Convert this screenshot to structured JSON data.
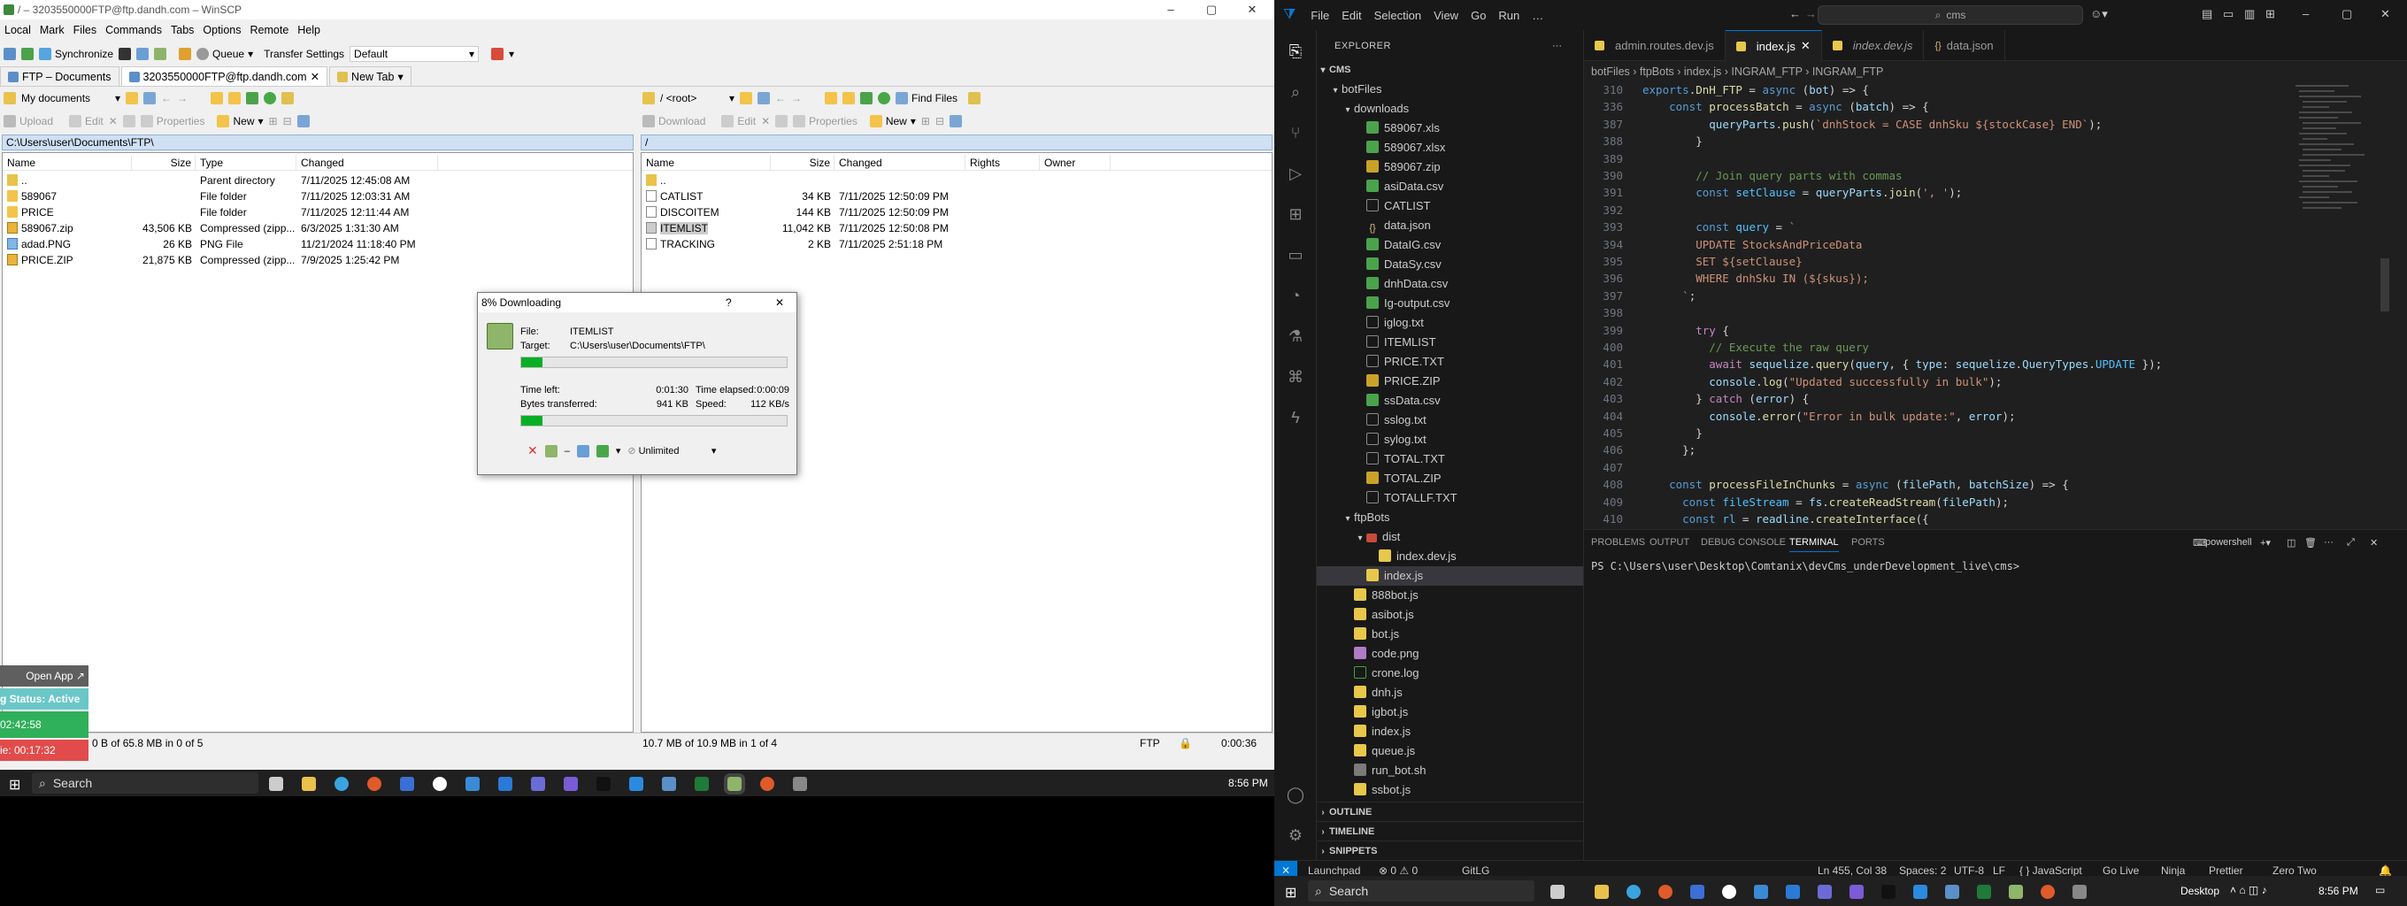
{
  "winscp": {
    "title": "/ – 3203550000FTP@ftp.dandh.com – WinSCP",
    "menu": [
      "Local",
      "Mark",
      "Files",
      "Commands",
      "Tabs",
      "Options",
      "Remote",
      "Help"
    ],
    "toolbar": {
      "synchronize": "Synchronize",
      "queue": "Queue",
      "transfer_settings": "Transfer Settings",
      "transfer_preset": "Default"
    },
    "tabs": [
      {
        "label": "FTP – Documents"
      },
      {
        "label": "3203550000FTP@ftp.dandh.com"
      },
      {
        "label": "New Tab"
      }
    ],
    "left": {
      "location": "My documents",
      "actions": {
        "upload": "Upload",
        "edit": "Edit",
        "properties": "Properties",
        "new": "New"
      },
      "path": "C:\\Users\\user\\Documents\\FTP\\",
      "headers": [
        "Name",
        "Size",
        "Type",
        "Changed"
      ],
      "rows": [
        {
          "name": "..",
          "size": "",
          "type": "Parent directory",
          "changed": "7/11/2025 12:45:08 AM",
          "icon": "up"
        },
        {
          "name": "589067",
          "size": "",
          "type": "File folder",
          "changed": "7/11/2025 12:03:31 AM",
          "icon": "folder"
        },
        {
          "name": "PRICE",
          "size": "",
          "type": "File folder",
          "changed": "7/11/2025 12:11:44 AM",
          "icon": "folder"
        },
        {
          "name": "589067.zip",
          "size": "43,506 KB",
          "type": "Compressed (zipp...",
          "changed": "6/3/2025 1:31:30 AM",
          "icon": "zip"
        },
        {
          "name": "adad.PNG",
          "size": "26 KB",
          "type": "PNG File",
          "changed": "11/21/2024 11:18:40 PM",
          "icon": "png"
        },
        {
          "name": "PRICE.ZIP",
          "size": "21,875 KB",
          "type": "Compressed (zipp...",
          "changed": "7/9/2025 1:25:42 PM",
          "icon": "zip"
        }
      ],
      "status": "0 B of 65.8 MB in 0 of 5"
    },
    "right": {
      "location": "/ <root>",
      "find_files": "Find Files",
      "actions": {
        "download": "Download",
        "edit": "Edit",
        "properties": "Properties",
        "new": "New"
      },
      "path": "/",
      "headers": [
        "Name",
        "Size",
        "Changed",
        "Rights",
        "Owner"
      ],
      "rows": [
        {
          "name": "..",
          "size": "",
          "changed": "",
          "icon": "up"
        },
        {
          "name": "CATLIST",
          "size": "34 KB",
          "changed": "7/11/2025 12:50:09 PM",
          "icon": "doc"
        },
        {
          "name": "DISCOITEM",
          "size": "144 KB",
          "changed": "7/11/2025 12:50:09 PM",
          "icon": "doc"
        },
        {
          "name": "ITEMLIST",
          "size": "11,042 KB",
          "changed": "7/11/2025 12:50:08 PM",
          "icon": "doc"
        },
        {
          "name": "TRACKING",
          "size": "2 KB",
          "changed": "7/11/2025 2:51:18 PM",
          "icon": "doc"
        }
      ],
      "status": "10.7 MB of 10.9 MB in 1 of 4"
    },
    "status_right": {
      "protocol": "FTP",
      "elapsed": "0:00:36"
    },
    "dialog": {
      "title": "8% Downloading",
      "help": "?",
      "close": "✕",
      "file_label": "File:",
      "file_value": "ITEMLIST",
      "target_label": "Target:",
      "target_value": "C:\\Users\\user\\Documents\\FTP\\",
      "progress_file": 0.08,
      "time_left_label": "Time left:",
      "time_left": "0:01:30",
      "time_elapsed_label": "Time elapsed:",
      "time_elapsed": "0:00:09",
      "bytes_label": "Bytes transferred:",
      "bytes": "941 KB",
      "speed_label": "Speed:",
      "speed": "112 KB/s",
      "progress_total": 0.08,
      "speed_limit": "Unlimited"
    },
    "overlay": {
      "open_app": "Open App ↗",
      "status": "g Status: Active",
      "time1": "02:42:58",
      "time2": "ie: 00:17:32"
    }
  },
  "taskbar_left": {
    "search": "Search",
    "time": "8:56 PM"
  },
  "vscode": {
    "menu": [
      "File",
      "Edit",
      "Selection",
      "View",
      "Go",
      "Run",
      "…"
    ],
    "search": "cms",
    "explorer_title": "EXPLORER",
    "root": "CMS",
    "tree": [
      {
        "label": "botFiles",
        "kind": "folder-open",
        "depth": 1
      },
      {
        "label": "downloads",
        "kind": "folder-open",
        "depth": 2
      },
      {
        "label": "589067.xls",
        "kind": "csv",
        "depth": 3
      },
      {
        "label": "589067.xlsx",
        "kind": "csv",
        "depth": 3
      },
      {
        "label": "589067.zip",
        "kind": "zip",
        "depth": 3
      },
      {
        "label": "asiData.csv",
        "kind": "csv",
        "depth": 3
      },
      {
        "label": "CATLIST",
        "kind": "txt",
        "depth": 3
      },
      {
        "label": "data.json",
        "kind": "json",
        "depth": 3
      },
      {
        "label": "DataIG.csv",
        "kind": "csv",
        "depth": 3
      },
      {
        "label": "DataSy.csv",
        "kind": "csv",
        "depth": 3
      },
      {
        "label": "dnhData.csv",
        "kind": "csv",
        "depth": 3
      },
      {
        "label": "Ig-output.csv",
        "kind": "csv",
        "depth": 3
      },
      {
        "label": "iglog.txt",
        "kind": "txt",
        "depth": 3
      },
      {
        "label": "ITEMLIST",
        "kind": "txt",
        "depth": 3
      },
      {
        "label": "PRICE.TXT",
        "kind": "txt",
        "depth": 3
      },
      {
        "label": "PRICE.ZIP",
        "kind": "zip",
        "depth": 3
      },
      {
        "label": "ssData.csv",
        "kind": "csv",
        "depth": 3
      },
      {
        "label": "sslog.txt",
        "kind": "txt",
        "depth": 3
      },
      {
        "label": "sylog.txt",
        "kind": "txt",
        "depth": 3
      },
      {
        "label": "TOTAL.TXT",
        "kind": "txt",
        "depth": 3
      },
      {
        "label": "TOTAL.ZIP",
        "kind": "zip",
        "depth": 3
      },
      {
        "label": "TOTALLF.TXT",
        "kind": "txt",
        "depth": 3
      },
      {
        "label": "ftpBots",
        "kind": "folder-open",
        "depth": 2
      },
      {
        "label": "dist",
        "kind": "folder-open",
        "depth": 3
      },
      {
        "label": "index.dev.js",
        "kind": "js",
        "depth": 4
      },
      {
        "label": "index.js",
        "kind": "js",
        "depth": 3
      },
      {
        "label": "888bot.js",
        "kind": "js",
        "depth": 2
      },
      {
        "label": "asibot.js",
        "kind": "js",
        "depth": 2
      },
      {
        "label": "bot.js",
        "kind": "js",
        "depth": 2
      },
      {
        "label": "code.png",
        "kind": "png",
        "depth": 2
      },
      {
        "label": "crone.log",
        "kind": "log",
        "depth": 2
      },
      {
        "label": "dnh.js",
        "kind": "js",
        "depth": 2
      },
      {
        "label": "igbot.js",
        "kind": "js",
        "depth": 2
      },
      {
        "label": "index.js",
        "kind": "js",
        "depth": 2
      },
      {
        "label": "queue.js",
        "kind": "js",
        "depth": 2
      },
      {
        "label": "run_bot.sh",
        "kind": "sh",
        "depth": 2
      },
      {
        "label": "ssbot.js",
        "kind": "js",
        "depth": 2
      }
    ],
    "sections": [
      "OUTLINE",
      "TIMELINE",
      "SNIPPETS"
    ],
    "tabs": [
      {
        "label": "admin.routes.dev.js",
        "active": false
      },
      {
        "label": "index.js",
        "active": true
      },
      {
        "label": "index.dev.js",
        "active": false
      },
      {
        "label": "data.json",
        "active": false
      }
    ],
    "breadcrumb": "botFiles  ›  ftpBots  ›  index.js  ›  INGRAM_FTP  ›  INGRAM_FTP",
    "code": [
      {
        "n": "310",
        "html": "<span class='kw'>exports</span><span class='pl'>.</span><span class='fn'>DnH_FTP</span><span class='pl'> = </span><span class='kw'>async</span><span class='pl'> (</span><span class='vr'>bot</span><span class='pl'>) =&gt; {</span>"
      },
      {
        "n": "336",
        "html": "<span class='pl'>    </span><span class='kw'>const</span><span class='pl'> </span><span class='fn'>processBatch</span><span class='pl'> = </span><span class='kw'>async</span><span class='pl'> (</span><span class='vr'>batch</span><span class='pl'>) =&gt; {</span>"
      },
      {
        "n": "387",
        "html": "<span class='pl'>          </span><span class='vr'>queryParts</span><span class='pl'>.</span><span class='fn'>push</span><span class='pl'>(</span><span class='st'>`dnhStock = CASE dnhSku ${stockCase} END`</span><span class='pl'>);</span>"
      },
      {
        "n": "388",
        "html": "<span class='pl'>        }</span>"
      },
      {
        "n": "389",
        "html": ""
      },
      {
        "n": "390",
        "html": "<span class='cm'>        // Join query parts with commas</span>"
      },
      {
        "n": "391",
        "html": "<span class='pl'>        </span><span class='kw'>const</span><span class='pl'> </span><span class='cn'>setClause</span><span class='pl'> = </span><span class='vr'>queryParts</span><span class='pl'>.</span><span class='fn'>join</span><span class='pl'>(</span><span class='st'>', '</span><span class='pl'>);</span>"
      },
      {
        "n": "392",
        "html": ""
      },
      {
        "n": "393",
        "html": "<span class='pl'>        </span><span class='kw'>const</span><span class='pl'> </span><span class='cn'>query</span><span class='pl'> = </span><span class='st'>`</span>"
      },
      {
        "n": "394",
        "html": "<span class='st'>        UPDATE StocksAndPriceData</span>"
      },
      {
        "n": "395",
        "html": "<span class='st'>        SET ${setClause}</span>"
      },
      {
        "n": "396",
        "html": "<span class='st'>        WHERE dnhSku IN (${skus});</span>"
      },
      {
        "n": "397",
        "html": "<span class='st'>      `</span><span class='pl'>;</span>"
      },
      {
        "n": "398",
        "html": ""
      },
      {
        "n": "399",
        "html": "<span class='pl'>        </span><span class='k2'>try</span><span class='pl'> {</span>"
      },
      {
        "n": "400",
        "html": "<span class='cm'>          // Execute the raw query</span>"
      },
      {
        "n": "401",
        "html": "<span class='pl'>          </span><span class='k2'>await</span><span class='pl'> </span><span class='vr'>sequelize</span><span class='pl'>.</span><span class='fn'>query</span><span class='pl'>(</span><span class='vr'>query</span><span class='pl'>, { </span><span class='vr'>type</span><span class='pl'>: </span><span class='vr'>sequelize</span><span class='pl'>.</span><span class='vr'>QueryTypes</span><span class='pl'>.</span><span class='cn'>UPDATE</span><span class='pl'> });</span>"
      },
      {
        "n": "402",
        "html": "<span class='pl'>          </span><span class='vr'>console</span><span class='pl'>.</span><span class='fn'>log</span><span class='pl'>(</span><span class='st'>\"Updated successfully in bulk\"</span><span class='pl'>);</span>"
      },
      {
        "n": "403",
        "html": "<span class='pl'>        } </span><span class='k2'>catch</span><span class='pl'> (</span><span class='vr'>error</span><span class='pl'>) {</span>"
      },
      {
        "n": "404",
        "html": "<span class='pl'>          </span><span class='vr'>console</span><span class='pl'>.</span><span class='fn'>error</span><span class='pl'>(</span><span class='st'>\"Error in bulk update:\"</span><span class='pl'>, </span><span class='vr'>error</span><span class='pl'>);</span>"
      },
      {
        "n": "405",
        "html": "<span class='pl'>        }</span>"
      },
      {
        "n": "406",
        "html": "<span class='pl'>      };</span>"
      },
      {
        "n": "407",
        "html": ""
      },
      {
        "n": "408",
        "html": "<span class='pl'>    </span><span class='kw'>const</span><span class='pl'> </span><span class='fn'>processFileInChunks</span><span class='pl'> = </span><span class='kw'>async</span><span class='pl'> (</span><span class='vr'>filePath</span><span class='pl'>, </span><span class='vr'>batchSize</span><span class='pl'>) =&gt; {</span>"
      },
      {
        "n": "409",
        "html": "<span class='pl'>      </span><span class='kw'>const</span><span class='pl'> </span><span class='cn'>fileStream</span><span class='pl'> = </span><span class='vr'>fs</span><span class='pl'>.</span><span class='fn'>createReadStream</span><span class='pl'>(</span><span class='vr'>filePath</span><span class='pl'>);</span>"
      },
      {
        "n": "410",
        "html": "<span class='pl'>      </span><span class='kw'>const</span><span class='pl'> </span><span class='cn'>rl</span><span class='pl'> = </span><span class='vr'>readline</span><span class='pl'>.</span><span class='fn'>createInterface</span><span class='pl'>({</span>"
      }
    ],
    "panel_tabs": [
      "PROBLEMS",
      "OUTPUT",
      "DEBUG CONSOLE",
      "TERMINAL",
      "PORTS"
    ],
    "terminal_name": "powershell",
    "terminal_line": "PS C:\\Users\\user\\Desktop\\Comtanix\\devCms_underDevelopment_live\\cms>",
    "status": {
      "remote": "⨯",
      "launchpad": "Launchpad",
      "problems": "⊗ 0 ⚠ 0",
      "gitlg": "GitLG",
      "position": "Ln 455, Col 38",
      "spaces": "Spaces: 2",
      "encoding": "UTF-8",
      "eol": "LF",
      "language": "{ } JavaScript",
      "golive": "Go Live",
      "ninja": "Ninja",
      "prettier": "Prettier",
      "zero": "Zero Two"
    }
  },
  "taskbar_right": {
    "search": "Search",
    "desktop": "Desktop",
    "time": "8:56 PM"
  }
}
